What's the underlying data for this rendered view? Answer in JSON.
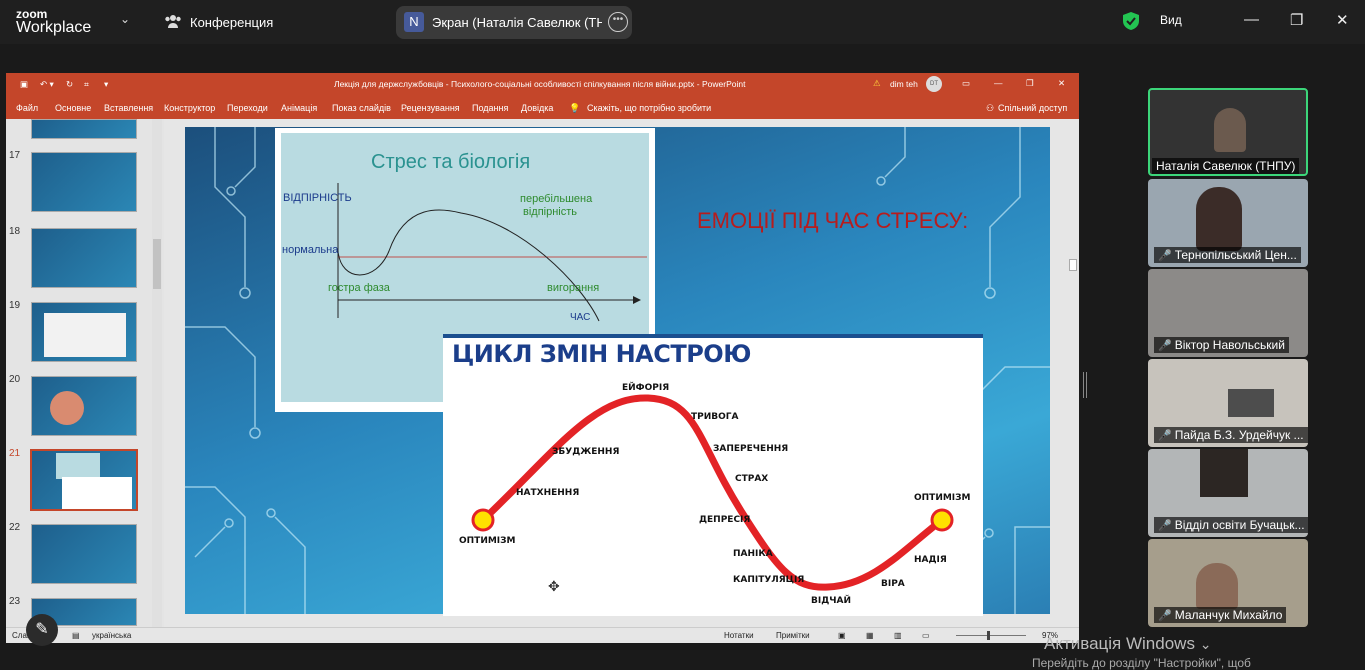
{
  "zoom": {
    "logo_line1": "zoom",
    "logo_line2": "Workplace",
    "conference_label": "Конференция",
    "share_avatar": "N",
    "share_title": "Экран (Наталія Савелюк (ТНПУ",
    "view_label": "Вид"
  },
  "ppt": {
    "window_title": "Лекція для держслужбовців - Психолого-соціальні особливості спілкування після війни.pptx  -  PowerPoint",
    "user_name": "dim teh",
    "user_initials": "DT",
    "tabs": [
      "Файл",
      "Основне",
      "Вставлення",
      "Конструктор",
      "Переходи",
      "Анімація",
      "Показ слайдів",
      "Рецензування",
      "Подання",
      "Довідка"
    ],
    "tell_me": "Скажіть, що потрібно зробити",
    "share_label": "Спільний доступ",
    "slide_numbers": [
      "17",
      "18",
      "19",
      "20",
      "21",
      "22",
      "23"
    ],
    "selected_slide": "21",
    "status": {
      "slide_info": "Слайд",
      "language": "українська",
      "notes": "Нотатки",
      "comments": "Примітки",
      "zoom": "97%"
    }
  },
  "slide": {
    "bio_title": "Стрес та біологія",
    "bio_resistance": "ВІДПІРНІСТЬ",
    "bio_exaggerated_1": "перебільшена",
    "bio_exaggerated_2": "відпірність",
    "bio_normal": "нормальна",
    "bio_acute": "гостра фаза",
    "bio_burnout": "вигорання",
    "bio_time": "ЧАС",
    "emotions_heading": "ЕМОЦІЇ ПІД ЧАС СТРЕСУ:",
    "cycle_title": "ЦИКЛ ЗМІН НАСТРОЮ",
    "cycle_labels": {
      "euphoria": "ЕЙФОРІЯ",
      "anxiety": "ТРИВОГА",
      "arousal": "ЗБУДЖЕННЯ",
      "denial": "ЗАПЕРЕЧЕННЯ",
      "fear": "СТРАХ",
      "inspiration": "НАТХНЕННЯ",
      "optimism_left": "ОПТИМІЗМ",
      "optimism_right": "ОПТИМІЗМ",
      "depression": "ДЕПРЕСІЯ",
      "panic": "ПАНІКА",
      "capitulation": "КАПІТУЛЯЦІЯ",
      "despair": "ВІДЧАЙ",
      "faith": "ВІРА",
      "hope": "НАДІЯ"
    }
  },
  "participants": [
    {
      "name": "Наталія Савелюк (ТНПУ)",
      "muted": false,
      "active": true
    },
    {
      "name": "Тернопільський Цен...",
      "muted": true,
      "active": false
    },
    {
      "name": "Віктор Навольський",
      "muted": true,
      "active": false
    },
    {
      "name": "Пайда Б.З. Урдейчук ...",
      "muted": true,
      "active": false
    },
    {
      "name": "Відділ освіти Бучацьк...",
      "muted": true,
      "active": false
    },
    {
      "name": "Маланчук Михайло",
      "muted": true,
      "active": false
    }
  ],
  "windows_activation": {
    "title": "Активація Windows",
    "subtitle": "Перейдіть до розділу \"Настройки\", щоб"
  },
  "colors": {
    "ppt_accent": "#c4462a",
    "active_speaker": "#3cd67a",
    "cycle_curve": "#e32326",
    "cycle_title": "#1b3e8a"
  }
}
